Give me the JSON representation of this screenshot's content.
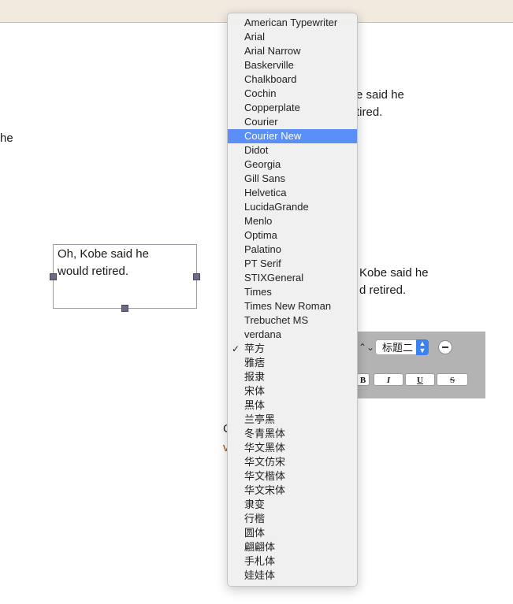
{
  "document": {
    "fragment_left": "he",
    "right_text_a": [
      "e said he",
      "tired."
    ],
    "right_text_b": [
      "Kobe said he",
      "d retired."
    ],
    "textbox_lines": [
      "Oh,  Kobe said he",
      "would retired."
    ],
    "behind_c": "C",
    "behind_v": "v"
  },
  "toolbar": {
    "heading_select": "标题二",
    "bold_label": "B",
    "italic_label": "I",
    "underline_label": "U",
    "strike_label": "S"
  },
  "font_menu": {
    "items": [
      "American Typewriter",
      "Arial",
      "Arial Narrow",
      "Baskerville",
      "Chalkboard",
      "Cochin",
      "Copperplate",
      "Courier",
      "Courier New",
      "Didot",
      "Georgia",
      "Gill Sans",
      "Helvetica",
      "LucidaGrande",
      "Menlo",
      "Optima",
      "Palatino",
      "PT Serif",
      "STIXGeneral",
      "Times",
      "Times New Roman",
      "Trebuchet MS",
      "verdana",
      "苹方",
      "雅痞",
      "报隶",
      "宋体",
      "黑体",
      "兰亭黑",
      "冬青黑体",
      "华文黑体",
      "华文仿宋",
      "华文楷体",
      "华文宋体",
      "隶变",
      "行楷",
      "圆体",
      "翩翩体",
      "手札体",
      "娃娃体"
    ],
    "highlighted": "Courier New",
    "checked": "苹方",
    "check_glyph": "✓"
  },
  "colors": {
    "highlight": "#5a8ff7",
    "topbar": "#f2e9df",
    "panel": "#b3b3b3",
    "stepper": "#3b82f0"
  }
}
